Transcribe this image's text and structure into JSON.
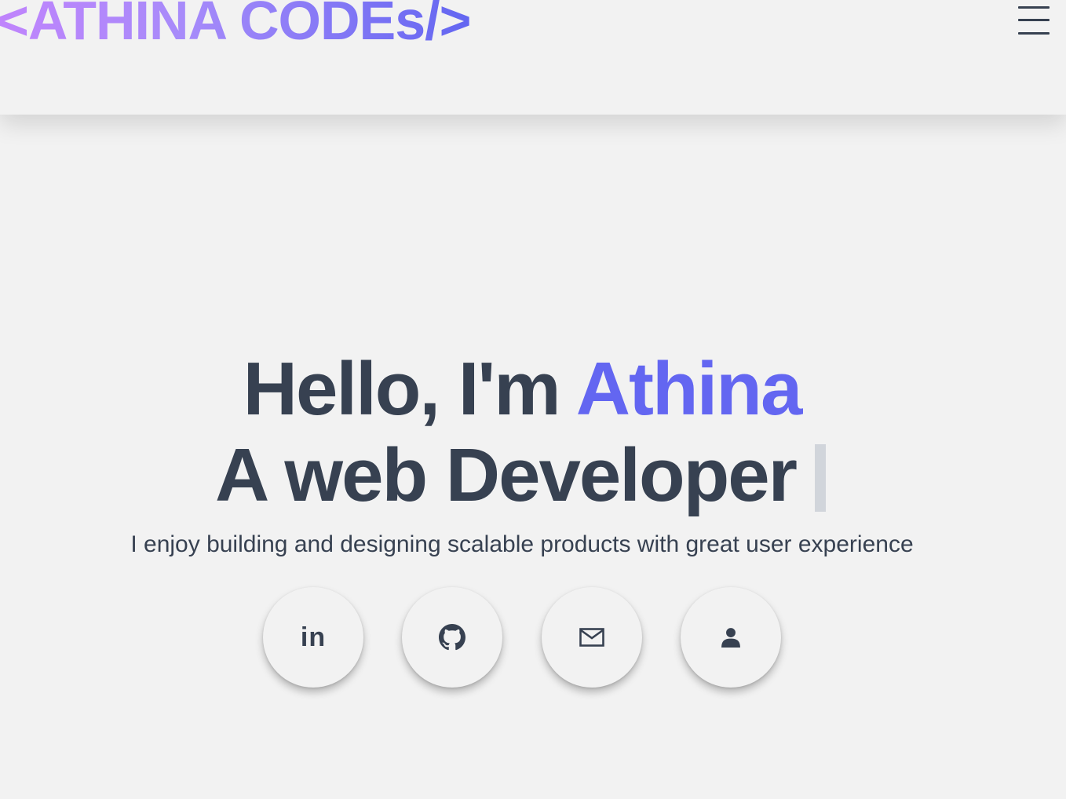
{
  "header": {
    "logo_text": "<ATHINA CODEs/>",
    "menu_icon": "hamburger-menu-icon"
  },
  "hero": {
    "greeting": "Hello, I'm ",
    "name": "Athina",
    "role": "A web Developer",
    "tagline": "I enjoy building and designing scalable products with great user experience"
  },
  "social_links": [
    {
      "name": "LinkedIn",
      "icon": "linkedin-icon",
      "glyph": "in"
    },
    {
      "name": "GitHub",
      "icon": "github-icon"
    },
    {
      "name": "Email",
      "icon": "mail-icon"
    },
    {
      "name": "Profile",
      "icon": "person-icon"
    }
  ],
  "colors": {
    "background": "#f2f2f2",
    "text": "#374151",
    "accent": "#6366f1",
    "logo_gradient_start": "#c084fc",
    "logo_gradient_end": "#6366f1",
    "cursor": "#d1d5db"
  }
}
